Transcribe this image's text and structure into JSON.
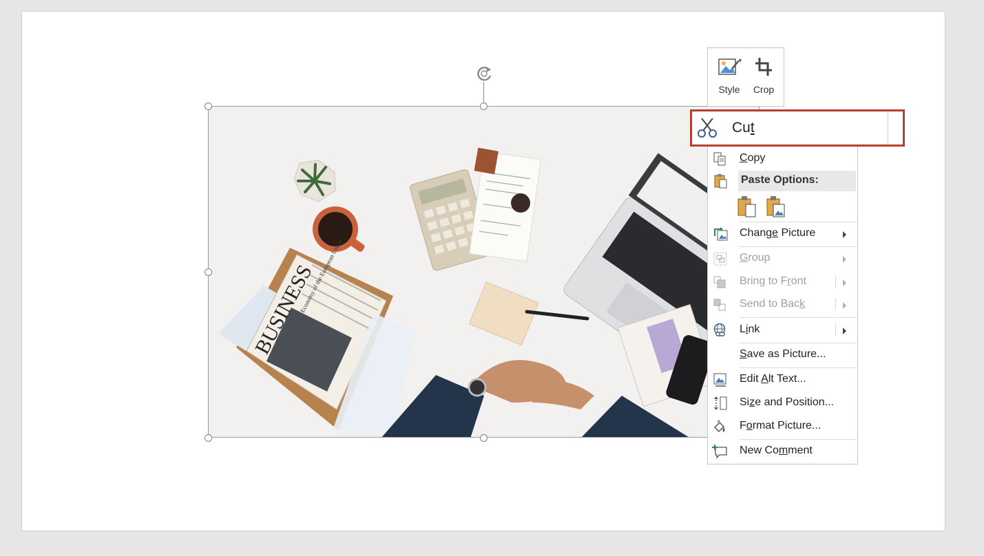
{
  "mini_toolbar": {
    "style_label": "Style",
    "crop_label": "Crop"
  },
  "context_menu": {
    "cut": {
      "pre": "Cu",
      "key": "t",
      "post": ""
    },
    "copy": {
      "pre": "",
      "key": "C",
      "post": "opy"
    },
    "paste_options_header": "Paste Options:",
    "change_picture": {
      "pre": "Chang",
      "key": "e",
      "post": " Picture"
    },
    "group": {
      "pre": "",
      "key": "G",
      "post": "roup"
    },
    "bring_to_front": {
      "pre": "Bring to F",
      "key": "r",
      "post": "ont"
    },
    "send_to_back": {
      "pre": "Send to Bac",
      "key": "k",
      "post": ""
    },
    "link": {
      "pre": "L",
      "key": "i",
      "post": "nk"
    },
    "save_as_picture": {
      "pre": "",
      "key": "S",
      "post": "ave as Picture..."
    },
    "edit_alt_text": {
      "pre": "Edit ",
      "key": "A",
      "post": "lt Text..."
    },
    "size_and_position": {
      "pre": "Si",
      "key": "z",
      "post": "e and Position..."
    },
    "format_picture": {
      "pre": "F",
      "key": "o",
      "post": "rmat Picture..."
    },
    "new_comment": {
      "pre": "New Co",
      "key": "m",
      "post": "ment"
    }
  },
  "picture": {
    "newspaper_headline": "BUSINESS",
    "newspaper_sub": "Economy of the European Union"
  },
  "colors": {
    "highlight_border": "#b3412b",
    "paste_header_bg": "#e8e8e8",
    "slide_bg": "#ffffff"
  }
}
